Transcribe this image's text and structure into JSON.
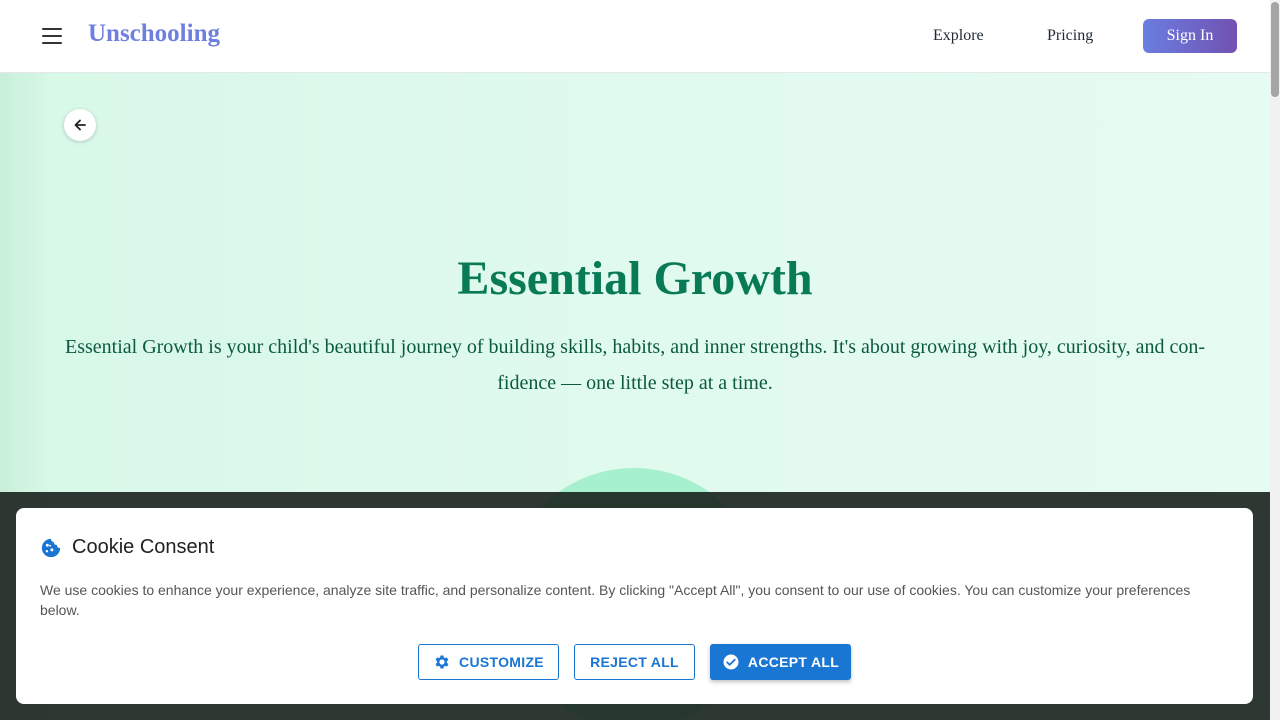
{
  "header": {
    "brand": "Unschooling",
    "nav": {
      "explore": "Explore",
      "pricing": "Pricing"
    },
    "signin_label": "Sign In"
  },
  "hero": {
    "title": "Essential Growth",
    "description": "Essential Growth is your child's beautiful journey of building skills, habits, and inner strengths. It's about growing with joy, curiosity, and con­fidence — one little step at a time."
  },
  "cookie": {
    "title": "Cookie Consent",
    "text": "We use cookies to enhance your experience, analyze site traffic, and personalize content. By clicking \"Accept All\", you consent to our use of cookies. You can customize your preferences below.",
    "buttons": {
      "customize": "CUSTOMIZE",
      "reject": "REJECT ALL",
      "accept": "ACCEPT ALL"
    }
  },
  "colors": {
    "brand": "#6f7fe0",
    "hero_title": "#087a55",
    "primary": "#1976d2"
  },
  "icons": {
    "menu": "menu-icon",
    "back": "arrow-left-icon",
    "cookie": "cookie-icon",
    "customize": "gear-icon",
    "accept": "check-circle-icon"
  }
}
